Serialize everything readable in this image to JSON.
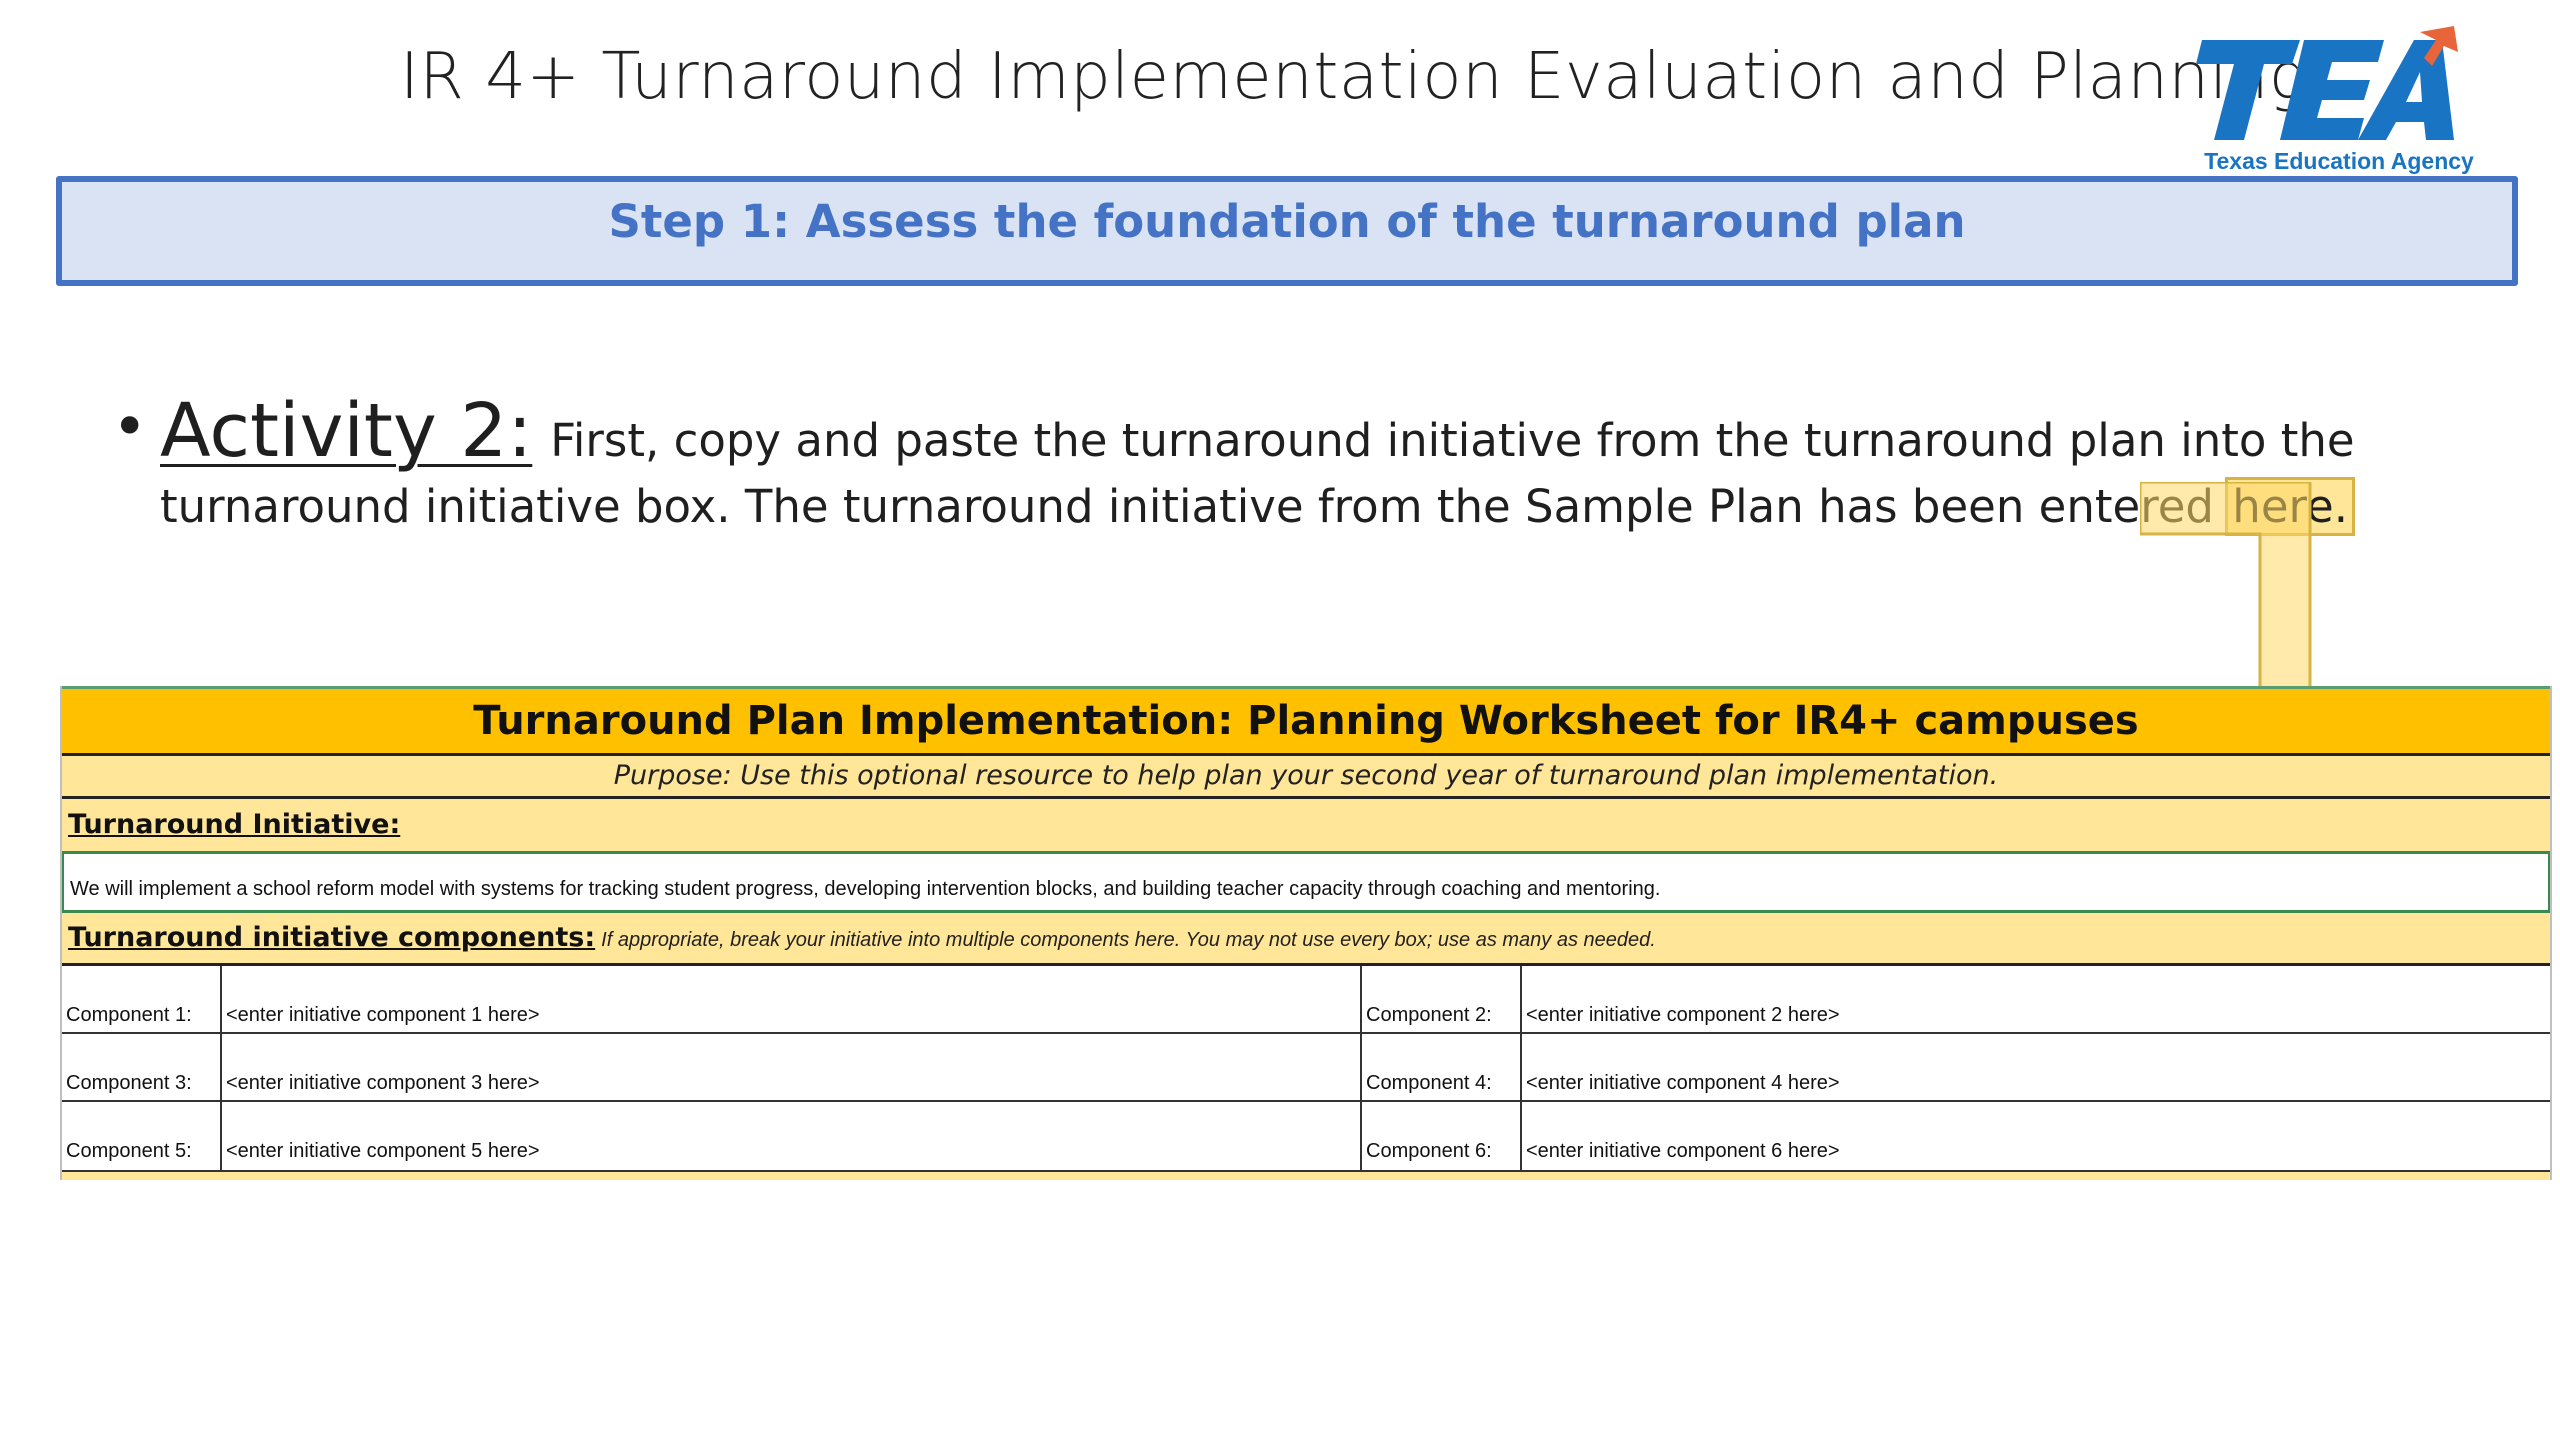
{
  "slide": {
    "title": "IR 4+ Turnaround Implementation Evaluation and  Planning",
    "logo": {
      "letters": "TEA",
      "caption": "Texas Education Agency",
      "colors": {
        "blue": "#1a74c4",
        "orange": "#e8643a"
      }
    },
    "step_banner": "Step 1: Assess the foundation of the turnaround plan"
  },
  "activity": {
    "bullet": "•",
    "heading": "Activity 2:",
    "line1": "First, copy and paste the turnaround initiative from the turnaround plan into the",
    "line2": "turnaround initiative box. The turnaround initiative from the Sample Plan has been entered",
    "here": "here."
  },
  "worksheet": {
    "title": "Turnaround Plan Implementation: Planning Worksheet for IR4+ campuses",
    "purpose": "Purpose: Use this optional resource to help plan your second year of turnaround plan implementation.",
    "initiative_label": "Turnaround Initiative:",
    "initiative_text": "We will implement a school reform model with systems for tracking student progress, developing intervention blocks, and building teacher capacity through coaching and mentoring.",
    "components_label": "Turnaround initiative components:",
    "components_note": "If appropriate, break your initiative into multiple components here. You may not use every box; use as many  as needed.",
    "components": [
      {
        "label": "Component 1:",
        "value": "<enter initiative component 1 here>"
      },
      {
        "label": "Component 2:",
        "value": "<enter initiative component 2 here>"
      },
      {
        "label": "Component 3:",
        "value": "<enter initiative component 3 here>"
      },
      {
        "label": "Component 4:",
        "value": "<enter initiative component 4 here>"
      },
      {
        "label": "Component 5:",
        "value": "<enter initiative component 5 here>"
      },
      {
        "label": "Component 6:",
        "value": "<enter initiative component 6 here>"
      }
    ],
    "colors": {
      "title_fill": "#ffc000",
      "light_fill": "#ffe699",
      "banner_fill": "#dae3f3",
      "banner_border": "#4472c4"
    }
  }
}
